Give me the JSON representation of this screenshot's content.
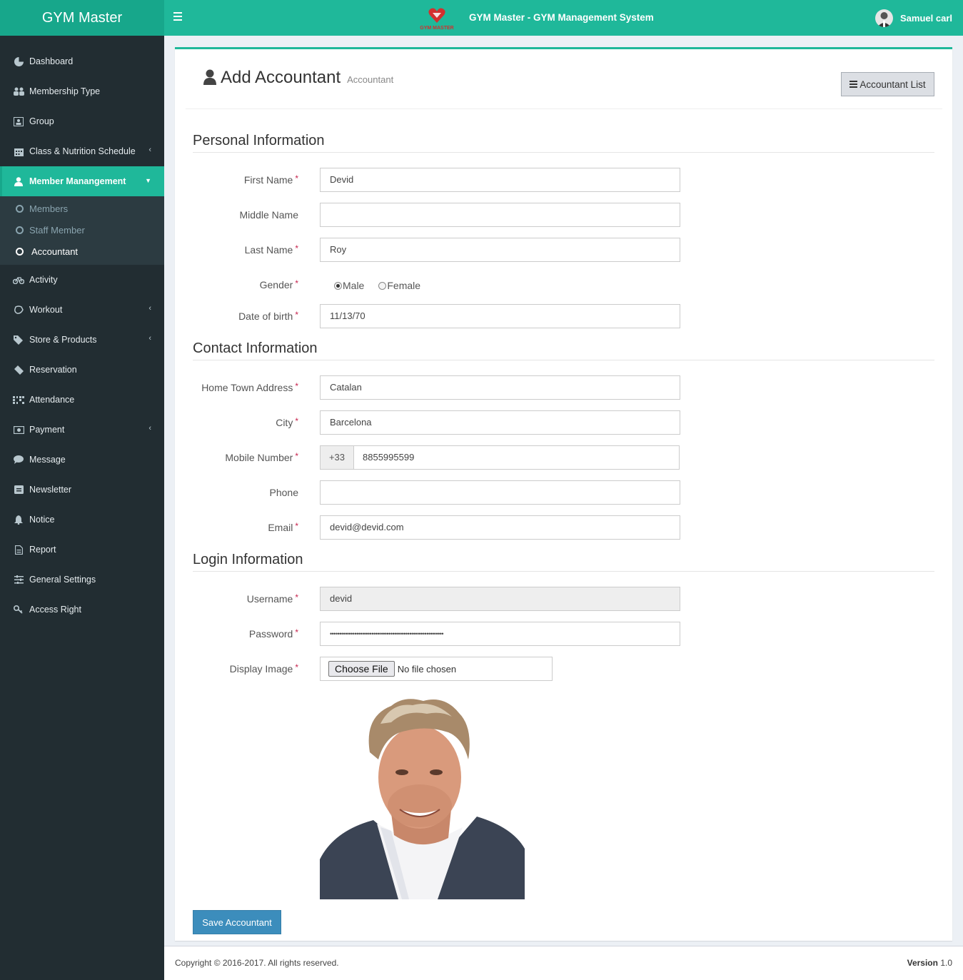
{
  "header": {
    "brand": "GYM Master",
    "app_title": "GYM Master - GYM Management System",
    "logo_text": "GYM MASTER",
    "user_name": "Samuel carl"
  },
  "sidebar": {
    "items": [
      {
        "label": "Dashboard",
        "icon": "dashboard-icon"
      },
      {
        "label": "Membership Type",
        "icon": "users-icon"
      },
      {
        "label": "Group",
        "icon": "group-icon"
      },
      {
        "label": "Class & Nutrition Schedule",
        "icon": "calendar-icon"
      },
      {
        "label": "Member Manangement",
        "icon": "user-icon"
      },
      {
        "label": "Activity",
        "icon": "bicycle-icon"
      },
      {
        "label": "Workout",
        "icon": "workout-icon"
      },
      {
        "label": "Store & Products",
        "icon": "tag-icon"
      },
      {
        "label": "Reservation",
        "icon": "ticket-icon"
      },
      {
        "label": "Attendance",
        "icon": "attendance-icon"
      },
      {
        "label": "Payment",
        "icon": "money-icon"
      },
      {
        "label": "Message",
        "icon": "message-icon"
      },
      {
        "label": "Newsletter",
        "icon": "newsletter-icon"
      },
      {
        "label": "Notice",
        "icon": "bell-icon"
      },
      {
        "label": "Report",
        "icon": "report-icon"
      },
      {
        "label": "General Settings",
        "icon": "sliders-icon"
      },
      {
        "label": "Access Right",
        "icon": "key-icon"
      }
    ],
    "submenu": [
      "Members",
      "Staff Member",
      "Accountant"
    ]
  },
  "page": {
    "title": "Add Accountant",
    "subtitle": "Accountant",
    "list_button": "Accountant List"
  },
  "sections": {
    "personal": "Personal Information",
    "contact": "Contact Information",
    "login": "Login Information"
  },
  "form": {
    "first_name": {
      "label": "First Name",
      "value": "Devid"
    },
    "middle_name": {
      "label": "Middle Name",
      "value": ""
    },
    "last_name": {
      "label": "Last Name",
      "value": "Roy"
    },
    "gender": {
      "label": "Gender",
      "options": [
        "Male",
        "Female"
      ],
      "selected": "Male"
    },
    "dob": {
      "label": "Date of birth",
      "value": "11/13/70"
    },
    "address": {
      "label": "Home Town Address",
      "value": "Catalan"
    },
    "city": {
      "label": "City",
      "value": "Barcelona"
    },
    "mobile": {
      "label": "Mobile Number",
      "prefix": "+33",
      "value": "8855995599"
    },
    "phone": {
      "label": "Phone",
      "value": ""
    },
    "email": {
      "label": "Email",
      "value": "devid@devid.com"
    },
    "username": {
      "label": "Username",
      "value": "devid"
    },
    "password": {
      "label": "Password",
      "value": "••••••••••••••••••••••••••••••••••••••••••••••••••••••••••••"
    },
    "display_image": {
      "label": "Display Image",
      "button": "Choose File",
      "status": "No file chosen"
    },
    "required_mark": "*",
    "save_button": "Save Accountant"
  },
  "footer": {
    "copyright": "Copyright © 2016-2017. All rights reserved.",
    "version_label": "Version",
    "version": "1.0"
  },
  "colors": {
    "accent": "#1fb89a",
    "sidebar_bg": "#222d32",
    "primary_button": "#3c8dbc"
  }
}
